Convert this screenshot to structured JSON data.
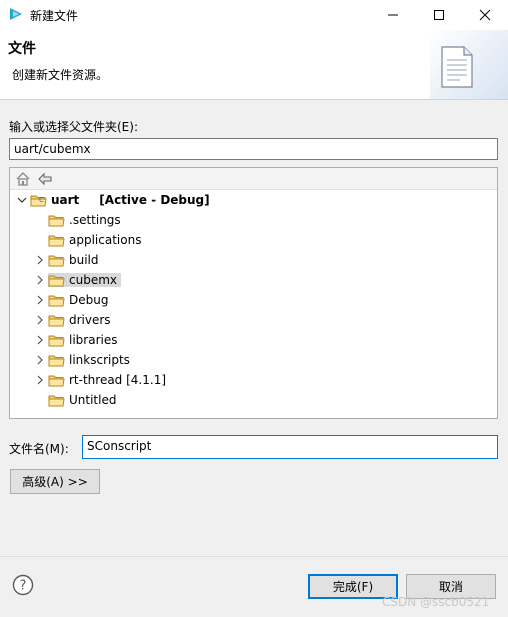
{
  "window": {
    "title": "新建文件"
  },
  "banner": {
    "title": "文件",
    "description": "创建新文件资源。"
  },
  "folder": {
    "label": "输入或选择父文件夹(E):",
    "value": "uart/cubemx"
  },
  "tree": {
    "root": {
      "label": "uart",
      "status": "[Active - Debug]"
    },
    "items": [
      {
        "label": ".settings",
        "expandable": false,
        "selected": false
      },
      {
        "label": "applications",
        "expandable": false,
        "selected": false
      },
      {
        "label": "build",
        "expandable": true,
        "selected": false
      },
      {
        "label": "cubemx",
        "expandable": true,
        "selected": true
      },
      {
        "label": "Debug",
        "expandable": true,
        "selected": false
      },
      {
        "label": "drivers",
        "expandable": true,
        "selected": false
      },
      {
        "label": "libraries",
        "expandable": true,
        "selected": false
      },
      {
        "label": "linkscripts",
        "expandable": true,
        "selected": false
      },
      {
        "label": "rt-thread [4.1.1]",
        "expandable": true,
        "selected": false
      },
      {
        "label": "Untitled",
        "expandable": false,
        "selected": false
      }
    ]
  },
  "filename": {
    "label": "文件名(M):",
    "value": "SConscript"
  },
  "buttons": {
    "advanced": "高级(A) >>",
    "finish": "完成(F)",
    "cancel": "取消"
  },
  "watermark": "CSDN @sscb0521",
  "icons": {
    "app": "app-icon",
    "minimize": "minimize-icon",
    "maximize": "maximize-icon",
    "close": "close-icon",
    "document": "document-icon",
    "home": "home-icon",
    "back": "back-arrow-icon",
    "folder": "folder-icon",
    "help": "help-icon"
  },
  "colors": {
    "accent": "#0078d7",
    "folder": "#e8b04a",
    "selection": "#d9d9d9"
  }
}
